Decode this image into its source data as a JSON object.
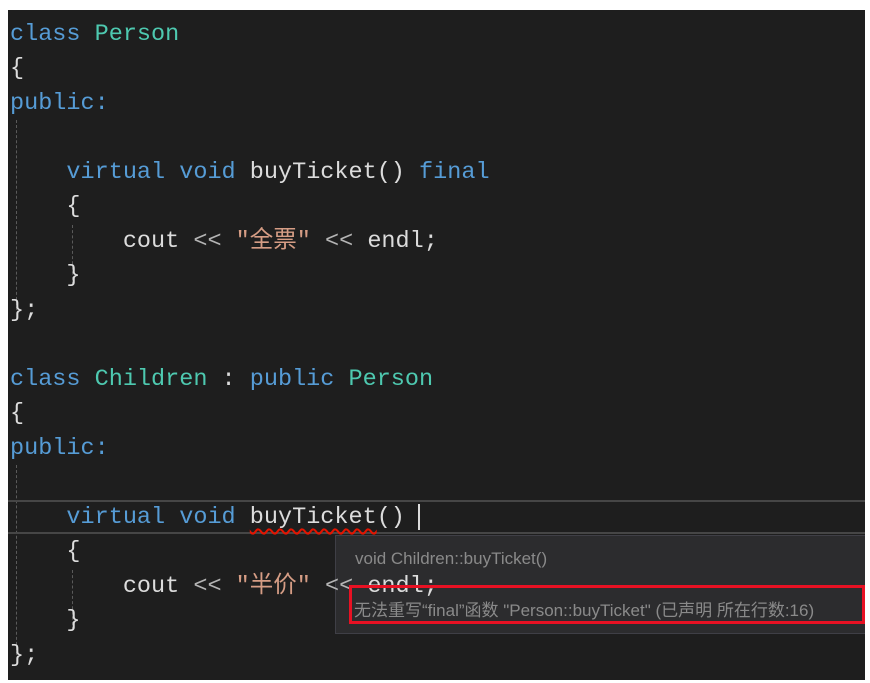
{
  "code": {
    "l1": {
      "kw": "class",
      "name": "Person"
    },
    "l2": "{",
    "l3": "public:",
    "l5": {
      "kw1": "virtual",
      "kw2": "void",
      "fn": "buyTicket",
      "paren": "()",
      "kw3": "final"
    },
    "l6": "{",
    "l7": {
      "a": "cout",
      "op": " << ",
      "s": "\"全票\"",
      "op2": " << ",
      "b": "endl;"
    },
    "l8": "}",
    "l9": "};",
    "l11": {
      "kw": "class",
      "name": "Children",
      "colon": " : ",
      "kw2": "public",
      "base": "Person"
    },
    "l12": "{",
    "l13": "public:",
    "l15": {
      "kw1": "virtual",
      "kw2": "void",
      "fn": "buyTicket",
      "paren": "()"
    },
    "l16": "{",
    "l17": {
      "a": "cout",
      "op": " << ",
      "s": "\"半价\"",
      "op2": " << ",
      "b": "endl;"
    },
    "l18": "}",
    "l19": "};"
  },
  "tooltip": {
    "signature": "void Children::buyTicket()",
    "error": "无法重写“final”函数 \"Person::buyTicket\" (已声明 所在行数:16)"
  },
  "colors": {
    "keyword": "#569cd6",
    "type": "#4ec9b0",
    "string": "#d69d85",
    "error_highlight": "#e81123"
  }
}
